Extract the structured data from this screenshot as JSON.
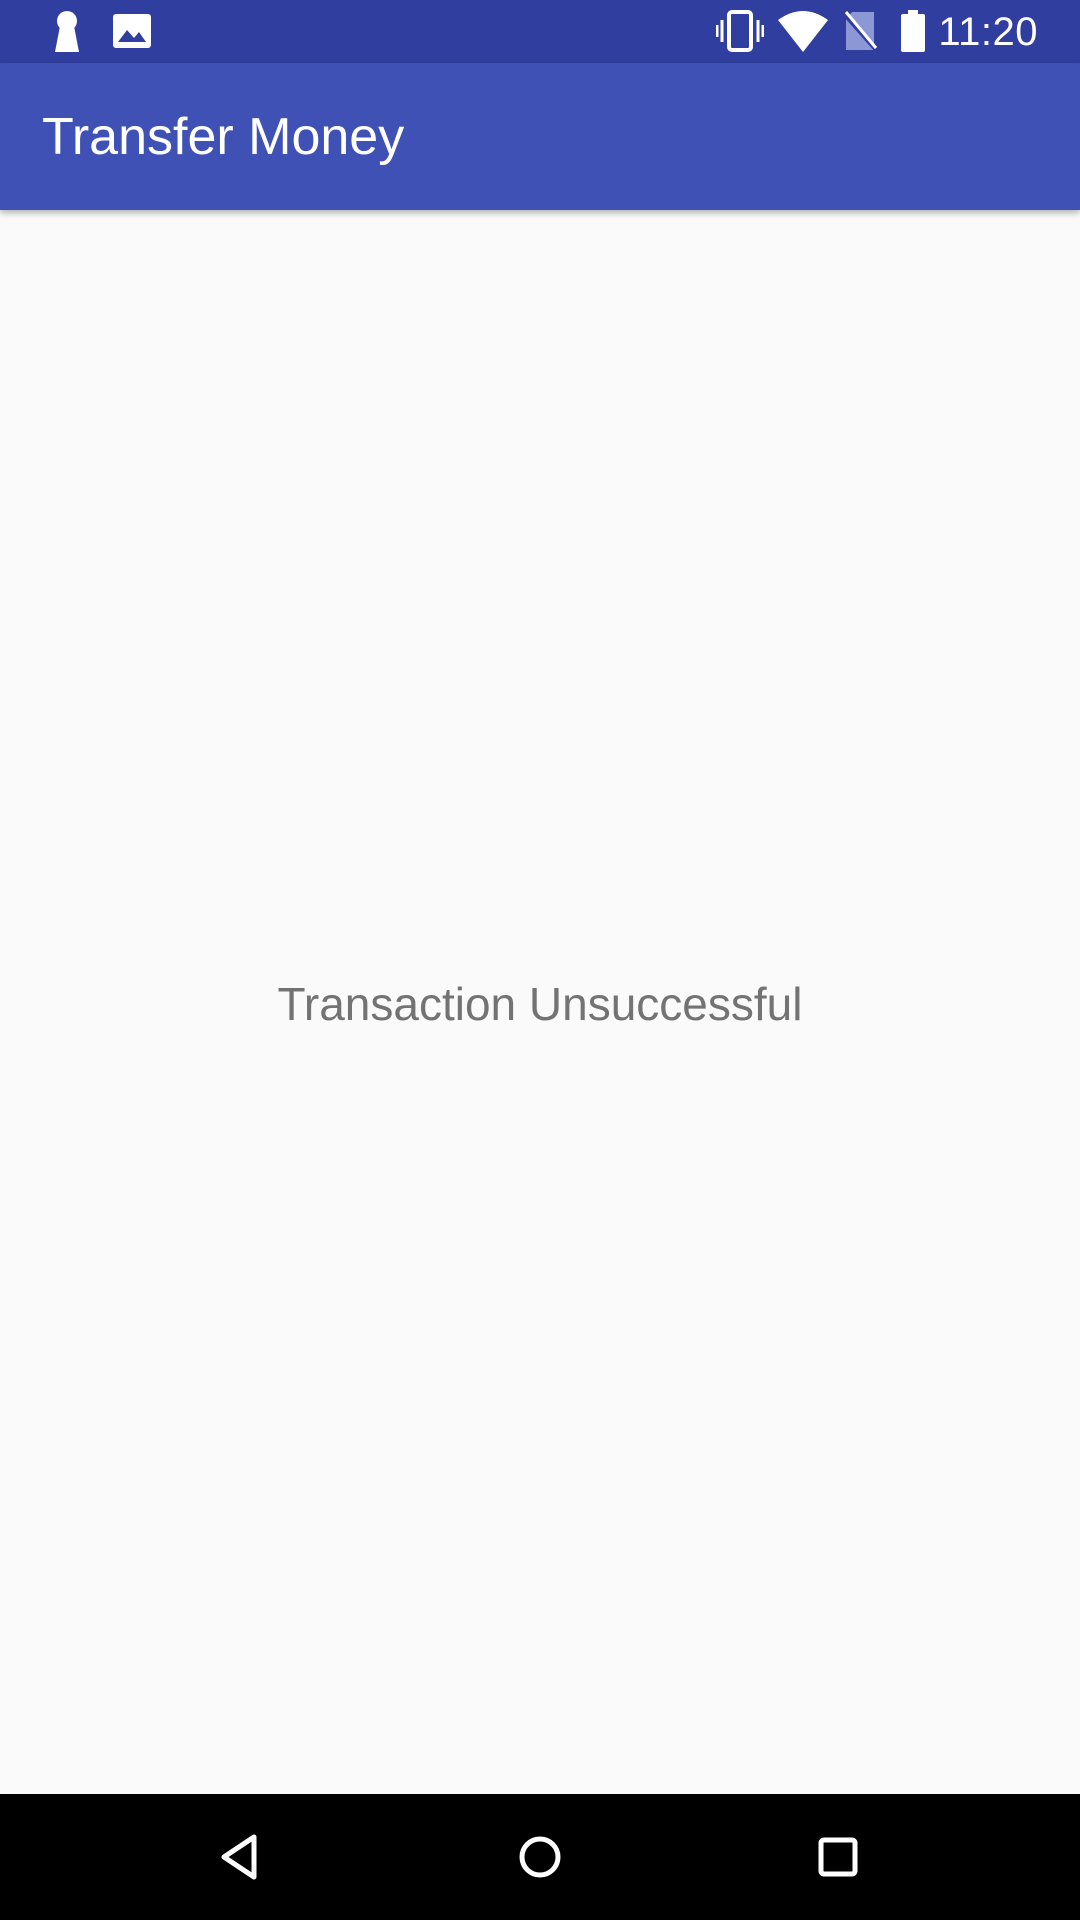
{
  "status_bar": {
    "time": "11:20",
    "left_icons": [
      "keyhole-icon",
      "image-icon"
    ],
    "right_icons": [
      "vibrate-icon",
      "wifi-icon",
      "no-sim-icon",
      "battery-icon"
    ]
  },
  "app_bar": {
    "title": "Transfer Money"
  },
  "main": {
    "message": "Transaction Unsuccessful"
  },
  "nav_bar": {
    "buttons": [
      "back-icon",
      "home-icon",
      "recents-icon"
    ]
  },
  "colors": {
    "status_bar": "#303f9f",
    "app_bar": "#3f51b5",
    "background": "#fafafa",
    "message_text": "#737373",
    "nav_bar": "#000000"
  }
}
